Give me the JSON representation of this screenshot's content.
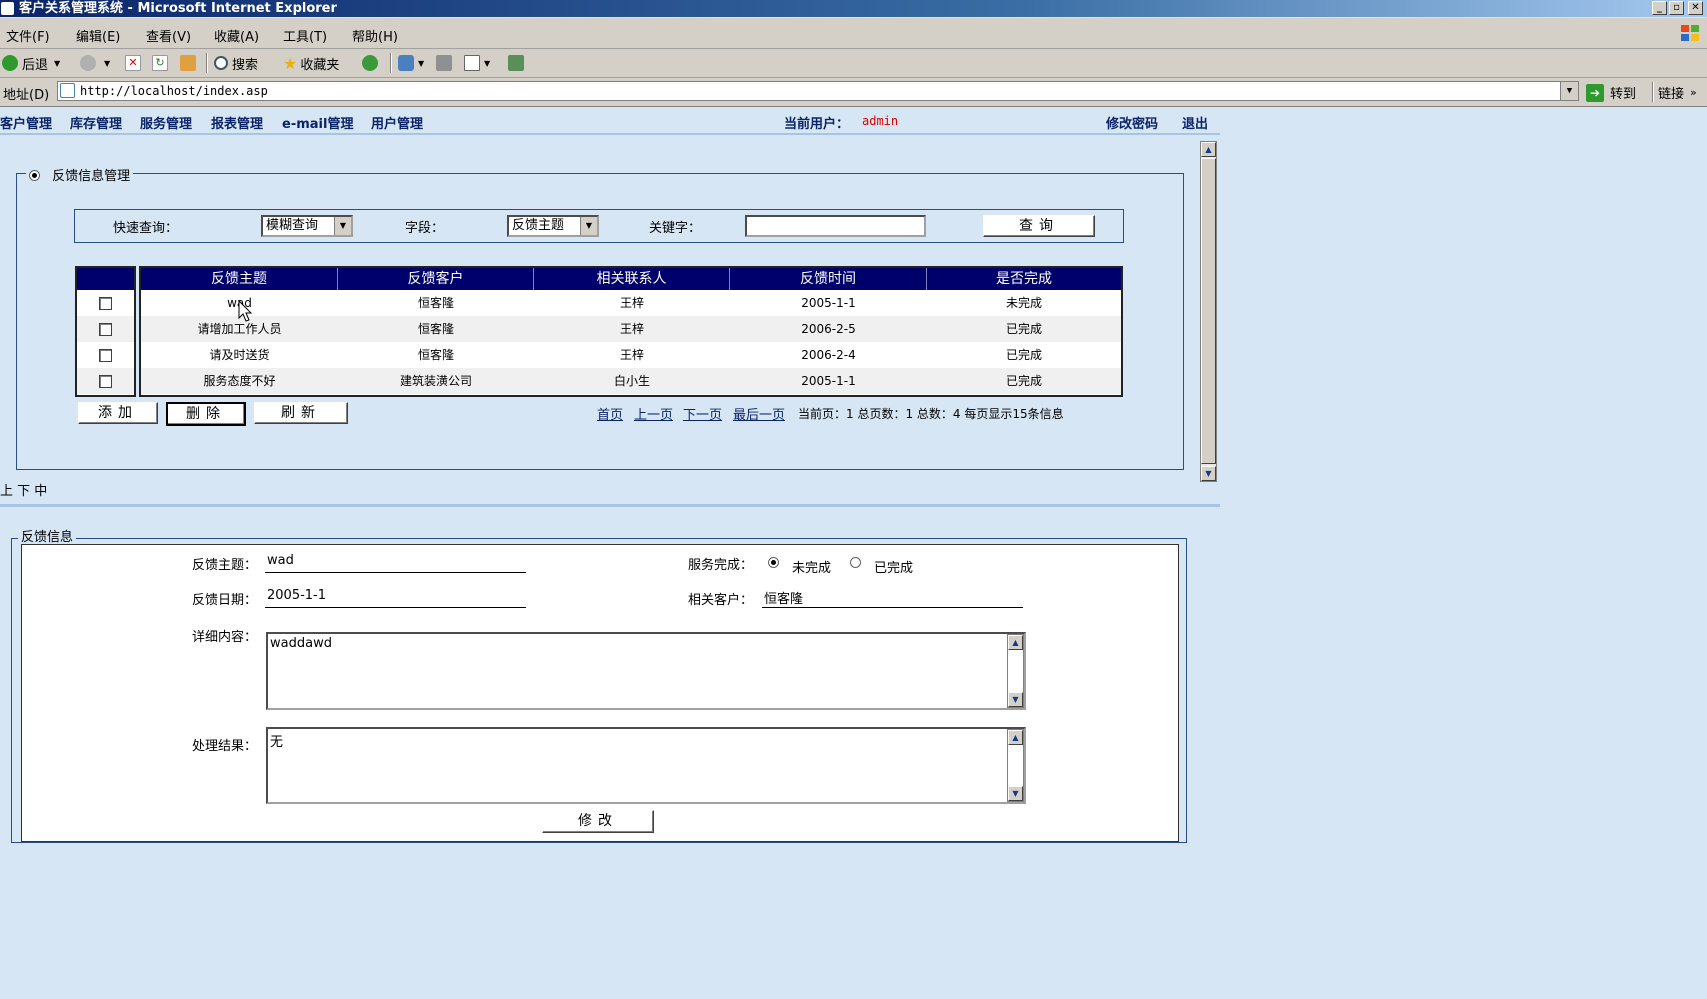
{
  "window": {
    "title": "客户关系管理系统 - Microsoft Internet Explorer"
  },
  "menu": [
    "文件(F)",
    "编辑(E)",
    "查看(V)",
    "收藏(A)",
    "工具(T)",
    "帮助(H)"
  ],
  "toolbar": {
    "back": "后退",
    "search": "搜索",
    "favorites": "收藏夹"
  },
  "address": {
    "label": "地址(D)",
    "url": "http://localhost/index.asp",
    "go": "转到",
    "links": "链接"
  },
  "nav": {
    "items": [
      "客户管理",
      "库存管理",
      "服务管理",
      "报表管理",
      "e-mail管理",
      "用户管理"
    ],
    "current_user_label": "当前用户：",
    "current_user": "admin",
    "change_password": "修改密码",
    "logout": "退出"
  },
  "panel": {
    "legend": "反馈信息管理"
  },
  "search": {
    "quick_label": "快速查询：",
    "mode": "模糊查询",
    "field_label": "字段：",
    "field": "反馈主题",
    "keyword_label": "关键字：",
    "keyword": "",
    "button": "查询"
  },
  "table": {
    "headers": [
      "反馈主题",
      "反馈客户",
      "相关联系人",
      "反馈时间",
      "是否完成"
    ],
    "rows": [
      [
        "wad",
        "恒客隆",
        "王梓",
        "2005-1-1",
        "未完成"
      ],
      [
        "请增加工作人员",
        "恒客隆",
        "王梓",
        "2006-2-5",
        "已完成"
      ],
      [
        "请及时送货",
        "恒客隆",
        "王梓",
        "2006-2-4",
        "已完成"
      ],
      [
        "服务态度不好",
        "建筑装潢公司",
        "白小生",
        "2005-1-1",
        "已完成"
      ]
    ]
  },
  "actions": {
    "add": "添加",
    "delete": "删除",
    "refresh": "刷新"
  },
  "pager": {
    "first": "首页",
    "prev": "上一页",
    "next": "下一页",
    "last": "最后一页",
    "info": "当前页：1 总页数：1 总数：4  每页显示15条信息"
  },
  "frame_controls": "上 下 中",
  "detail": {
    "legend": "反馈信息",
    "subject_label": "反馈主题：",
    "subject": "wad",
    "date_label": "反馈日期：",
    "date": "2005-1-1",
    "service_label": "服务完成：",
    "opt_incomplete": "未完成",
    "opt_complete": "已完成",
    "customer_label": "相关客户：",
    "customer": "恒客隆",
    "content_label": "详细内容：",
    "content": "waddawd",
    "result_label": "处理结果：",
    "result": "无",
    "modify": "修改"
  }
}
